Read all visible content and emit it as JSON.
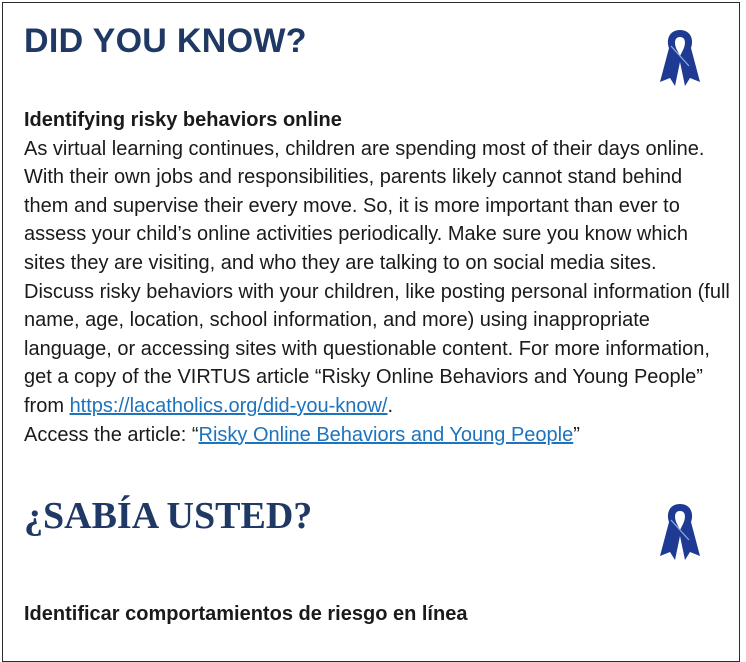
{
  "english": {
    "heading": "DID YOU KNOW?",
    "icon": "blue-ribbon-icon",
    "subheading": "Identifying risky behaviors online",
    "body": "As virtual learning continues, children are spending most of their days online. With their own jobs and responsibilities, parents likely cannot stand behind them and supervise their every move. So, it is more important than ever to assess your child’s online activities periodically. Make sure you know which sites they are visiting, and who they are talking to on social media sites. Discuss risky behaviors with your children, like posting personal information (full name, age, location, school information, and more) using inappropriate language, or accessing sites with questionable content.  For more information, get a copy of the VIRTUS article “Risky Online Behaviors and Young People” from ",
    "link_url_text": "https://lacatholics.org/did-you-know/",
    "after_link": ".",
    "access_prefix": "Access the article: “",
    "article_link_text": "Risky Online Behaviors and Young People",
    "access_suffix": "”"
  },
  "spanish": {
    "heading": "¿SABÍA USTED?",
    "icon": "blue-ribbon-icon",
    "subheading": "Identificar comportamientos de riesgo en línea"
  },
  "colors": {
    "heading": "#1f3864",
    "ribbon": "#1f3a93",
    "link": "#1e73be"
  }
}
